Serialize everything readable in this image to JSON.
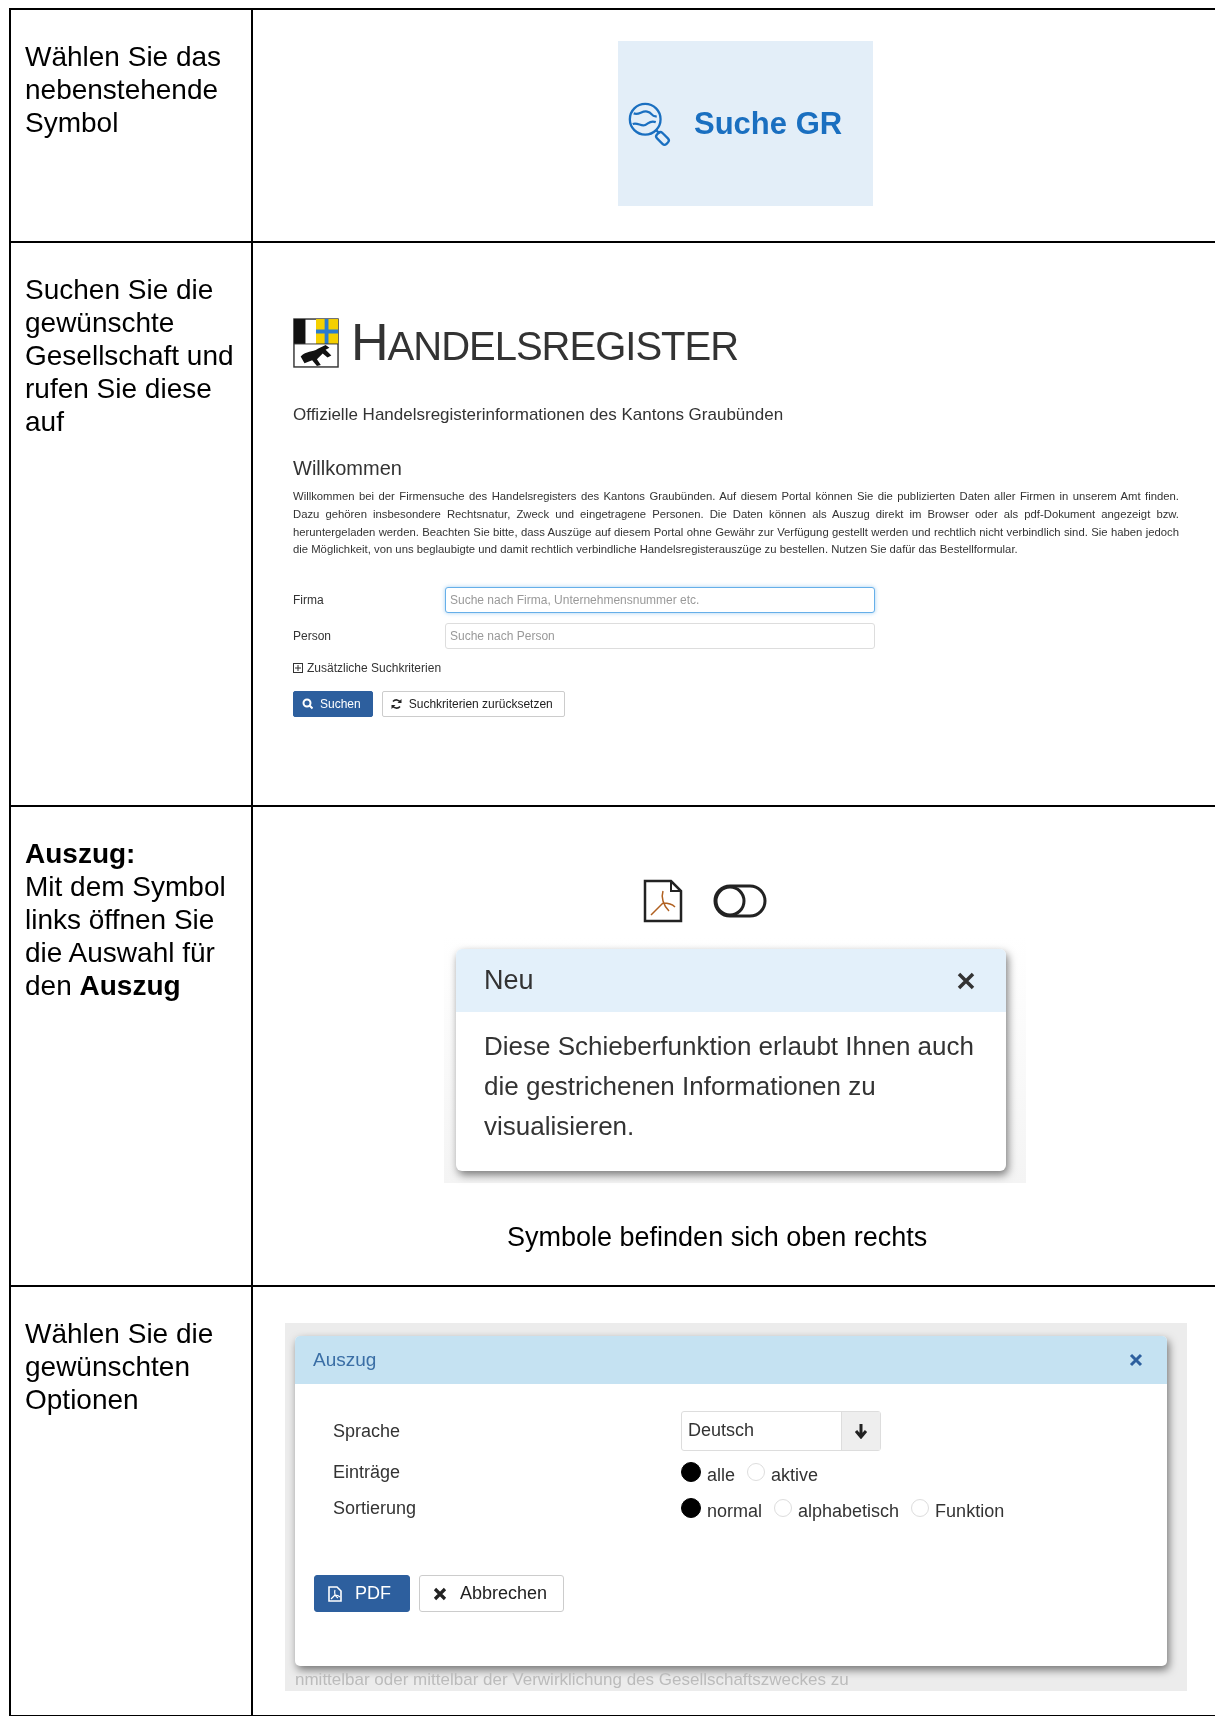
{
  "rows": [
    {
      "kind": "symbol",
      "instruction": "Wählen Sie das nebenstehende Symbol",
      "button": {
        "label": "Suche GR"
      }
    },
    {
      "kind": "portal",
      "instruction": "Suchen Sie die gewünschte Gesellschaft und rufen Sie diese auf",
      "portal": {
        "title": "HANDELSREGISTER",
        "subtitle": "Offizielle Handelsregisterinformationen des Kantons Graubünden",
        "heading": "Willkommen",
        "intro": "Willkommen bei der Firmensuche des Handelsregisters des Kantons Graubünden. Auf diesem Portal können Sie die publizierten Daten aller Firmen in unserem Amt finden. Dazu gehören insbesondere Rechtsnatur, Zweck und eingetragene Personen. Die Daten können als Auszug direkt im Browser oder als pdf-Dokument angezeigt bzw. heruntergeladen werden. Beachten Sie bitte, dass Auszüge auf diesem Portal ohne Gewähr zur Verfügung gestellt werden und rechtlich nicht verbindlich sind. Sie haben jedoch die Möglichkeit, von uns beglaubigte und damit rechtlich verbindliche Handelsregisterauszüge zu bestellen. Nutzen Sie dafür das Bestellformular.",
        "fields": [
          {
            "label": "Firma",
            "placeholder": "Suche nach Firma, Unternehmensnummer etc.",
            "focused": true
          },
          {
            "label": "Person",
            "placeholder": "Suche nach Person",
            "focused": false
          }
        ],
        "expander": {
          "label": "Zusätzliche Suchkriterien",
          "expanded": false
        },
        "buttons": [
          {
            "label": "Suchen",
            "kind": "search"
          },
          {
            "label": "Suchkriterien zurücksetzen",
            "kind": "reset"
          }
        ]
      }
    },
    {
      "kind": "popover",
      "instruction": "**Auszug:**\nMit dem Symbol links öffnen Sie die Auswahl für den **Auszug**",
      "popover": {
        "title": "Neu",
        "body": "Diese Schieberfunktion erlaubt Ihnen auch die gestrichenen Informationen zu visualisieren."
      },
      "caption": "Symbole befinden sich oben rechts"
    },
    {
      "kind": "dialog",
      "instruction": "Wählen Sie die gewünschten Optionen",
      "dialog": {
        "title": "Auszug",
        "language": {
          "label": "Sprache",
          "value": "Deutsch"
        },
        "groups": [
          {
            "label": "Einträge",
            "options": [
              {
                "label": "alle",
                "selected": true
              },
              {
                "label": "aktive",
                "selected": false
              }
            ]
          },
          {
            "label": "Sortierung",
            "options": [
              {
                "label": "normal",
                "selected": true
              },
              {
                "label": "alphabetisch",
                "selected": false
              },
              {
                "label": "Funktion",
                "selected": false
              }
            ]
          }
        ],
        "buttons": [
          {
            "label": "PDF",
            "kind": "pdf"
          },
          {
            "label": "Abbrechen",
            "kind": "cancel"
          }
        ],
        "background_text": "nmittelbar oder mittelbar der Verwirklichung des Gesellschaftszweckes zu"
      }
    }
  ]
}
